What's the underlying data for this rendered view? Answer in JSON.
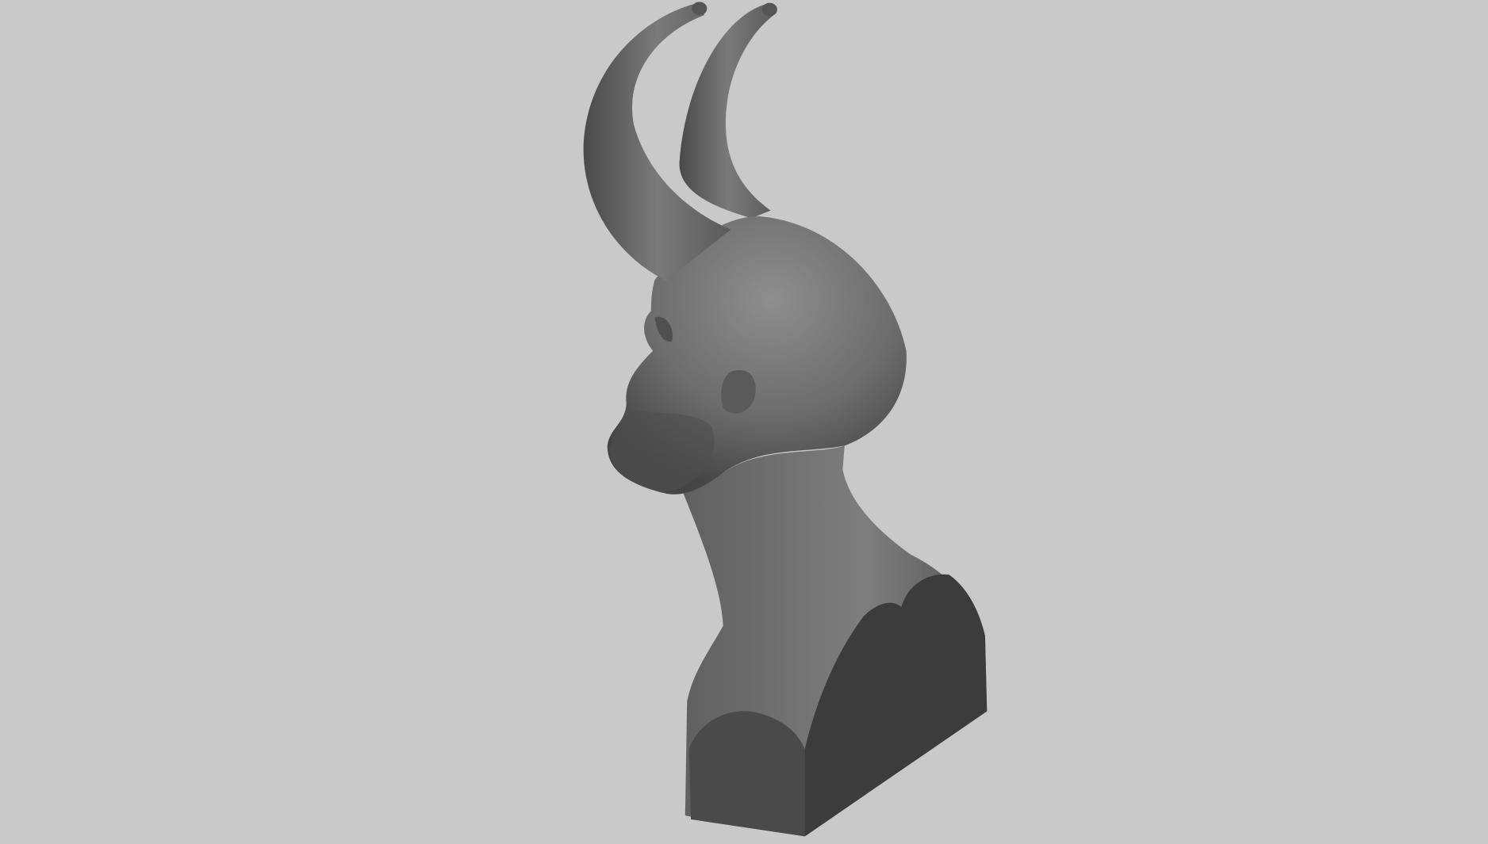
{
  "scene": {
    "subject": "horned-bust-sculpt",
    "colors": {
      "background": "#c9c9c9",
      "surface_light": "#8a8a8a",
      "surface_mid": "#6a6a6a",
      "surface_dark": "#3a3a3a",
      "cut_face": "#3d3d3d",
      "cut_face_front": "#4a4a4a"
    }
  }
}
